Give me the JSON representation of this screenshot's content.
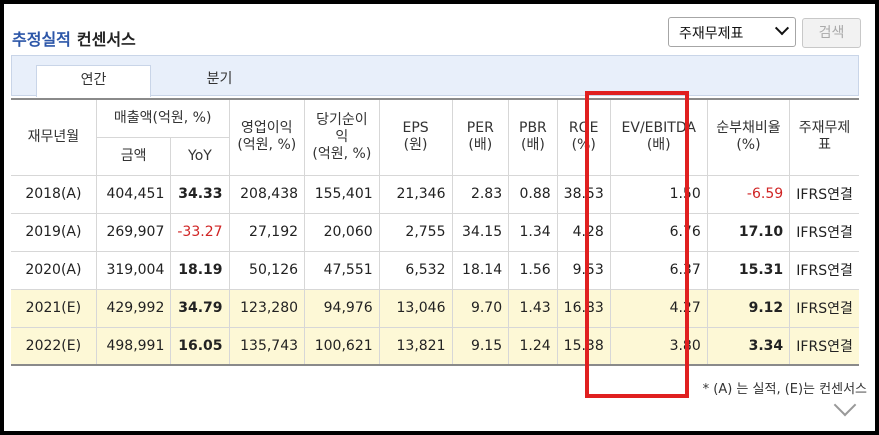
{
  "header": {
    "title_primary": "추정실적",
    "title_secondary": "컨센서스",
    "select_value": "주재무제표",
    "search_label": "검색"
  },
  "tabs": [
    {
      "label": "연간",
      "active": true
    },
    {
      "label": "분기",
      "active": false
    }
  ],
  "table": {
    "headers": {
      "fiscal_year": "재무년월",
      "sales_group": "매출액(억원, %)",
      "sales_amount": "금액",
      "sales_yoy": "YoY",
      "operating_profit": "영업이익\n(억원, %)",
      "net_income": "당기순이익\n(억원, %)",
      "eps": "EPS\n(원)",
      "per": "PER\n(배)",
      "pbr": "PBR\n(배)",
      "roe": "ROE\n(%)",
      "ev_ebitda": "EV/EBITDA\n(배)",
      "net_debt_ratio": "순부채비율\n(%)",
      "statement": "주재무제표"
    },
    "rows": [
      {
        "year": "2018(A)",
        "sales": "404,451",
        "yoy": "34.33",
        "op": "208,438",
        "ni": "155,401",
        "eps": "21,346",
        "per": "2.83",
        "pbr": "0.88",
        "roe": "38.53",
        "ev": "1.50",
        "debt": "-6.59",
        "stmt": "IFRS연결"
      },
      {
        "year": "2019(A)",
        "sales": "269,907",
        "yoy": "-33.27",
        "op": "27,192",
        "ni": "20,060",
        "eps": "2,755",
        "per": "34.15",
        "pbr": "1.34",
        "roe": "4.28",
        "ev": "6.76",
        "debt": "17.10",
        "stmt": "IFRS연결"
      },
      {
        "year": "2020(A)",
        "sales": "319,004",
        "yoy": "18.19",
        "op": "50,126",
        "ni": "47,551",
        "eps": "6,532",
        "per": "18.14",
        "pbr": "1.56",
        "roe": "9.53",
        "ev": "6.37",
        "debt": "15.31",
        "stmt": "IFRS연결"
      },
      {
        "year": "2021(E)",
        "sales": "429,992",
        "yoy": "34.79",
        "op": "123,280",
        "ni": "94,976",
        "eps": "13,046",
        "per": "9.70",
        "pbr": "1.43",
        "roe": "16.83",
        "ev": "4.27",
        "debt": "9.12",
        "stmt": "IFRS연결"
      },
      {
        "year": "2022(E)",
        "sales": "498,991",
        "yoy": "16.05",
        "op": "135,743",
        "ni": "100,621",
        "eps": "13,821",
        "per": "9.15",
        "pbr": "1.24",
        "roe": "15.38",
        "ev": "3.80",
        "debt": "3.34",
        "stmt": "IFRS연결"
      }
    ]
  },
  "footnote": "* (A) 는 실적, (E)는 컨센서스",
  "colors": {
    "title_blue": "#2c56a8",
    "negative": "#d02424",
    "estimate_row_bg": "#fdf8d6",
    "highlight_box": "#e02020"
  },
  "icons": {
    "select_arrow": "chevron-down-icon",
    "expand": "chevron-down-icon"
  }
}
